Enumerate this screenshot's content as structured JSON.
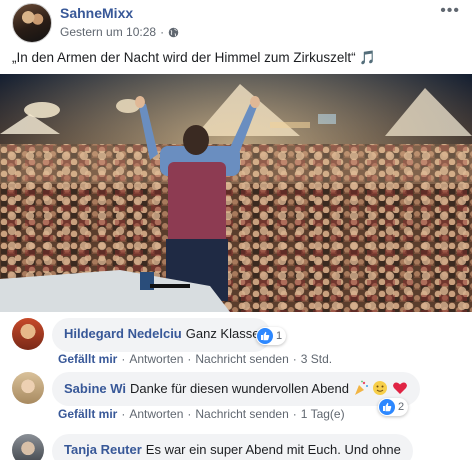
{
  "post": {
    "page_name": "SahneMixx",
    "time": "Gestern um 10:28",
    "separator": "·",
    "text": "„In den Armen der Nacht wird der Himmel zum Zirkuszelt“ 🎵",
    "more_icon": "more-options-icon",
    "privacy_icon": "globe-icon",
    "photo_icon": "concert-crowd-photo"
  },
  "comments": [
    {
      "author": "Hildegard Nedelciu",
      "text": "Ganz Klasse",
      "reactions": "1",
      "like_label": "Gefällt mir",
      "reply_label": "Antworten",
      "message_label": "Nachricht senden",
      "time": "3 Std."
    },
    {
      "author": "Sabine Wi",
      "text": "Danke für diesen wundervollen Abend",
      "emojis": [
        "party-popper-icon",
        "smiley-icon",
        "heart-icon"
      ],
      "reactions": "2",
      "like_label": "Gefällt mir",
      "reply_label": "Antworten",
      "message_label": "Nachricht senden",
      "time": "1 Tag(e)"
    },
    {
      "author": "Tanja Reuter",
      "text": "Es war ein super Abend mit Euch. Und ohne"
    }
  ],
  "colors": {
    "link": "#385898",
    "bubble": "#f2f3f5",
    "like_blue": "#2d88ff",
    "meta": "#606770"
  }
}
